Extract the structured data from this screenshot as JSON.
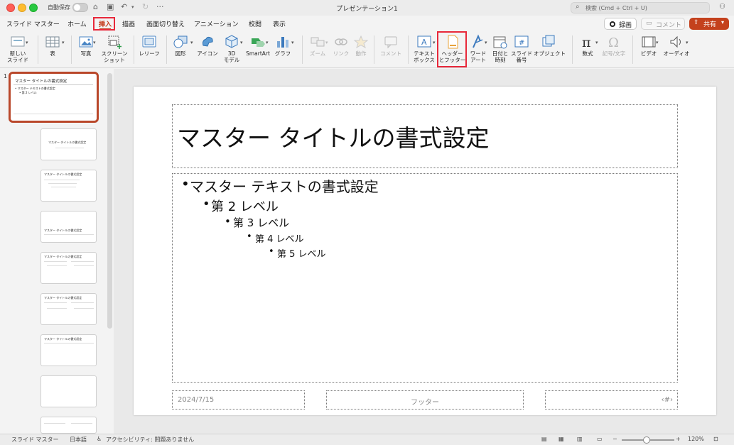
{
  "window": {
    "title": "プレゼンテーション1",
    "autosave_label": "自動保存"
  },
  "search": {
    "placeholder": "検索 (Cmd + Ctrl + U)"
  },
  "tabs": [
    {
      "label": "スライド マスター"
    },
    {
      "label": "ホーム"
    },
    {
      "label": "挿入",
      "active": true
    },
    {
      "label": "描画"
    },
    {
      "label": "画面切り替え"
    },
    {
      "label": "アニメーション"
    },
    {
      "label": "校閲"
    },
    {
      "label": "表示"
    }
  ],
  "top_buttons": {
    "record": "録画",
    "comment": "コメント",
    "share": "共有"
  },
  "ribbon": {
    "new_slide": "新しい\nスライド",
    "table": "表",
    "photo": "写真",
    "screenshot": "スクリーン\nショット",
    "relief": "レリーフ",
    "shapes": "図形",
    "icons": "アイコン",
    "model3d": "3D\nモデル",
    "smartart": "SmartArt",
    "chart": "グラフ",
    "zoom": "ズーム",
    "link": "リンク",
    "action": "動作",
    "comment": "コメント",
    "textbox": "テキスト\nボックス",
    "header_footer": "ヘッダー\nとフッター",
    "wordart": "ワード\nアート",
    "datetime": "日付と\n時刻",
    "slide_number": "スライド\n番号",
    "object": "オブジェクト",
    "equation": "数式",
    "symbol": "記号/文字",
    "video": "ビデオ",
    "audio": "オーディオ"
  },
  "thumbnails": {
    "first_number": "1",
    "master_title": "マスター タイトルの書式設定",
    "master_text": "• マスター テキストの書式設定",
    "level2": "• 第 2 レベル"
  },
  "slide": {
    "title": "マスター タイトルの書式設定",
    "bullets": [
      {
        "text": "マスター テキストの書式設定",
        "level": 1
      },
      {
        "text": "第 2 レベル",
        "level": 2
      },
      {
        "text": "第 3 レベル",
        "level": 3
      },
      {
        "text": "第 4 レベル",
        "level": 4
      },
      {
        "text": "第 5 レベル",
        "level": 5
      }
    ],
    "footer_date": "2024/7/15",
    "footer_text": "フッター",
    "footer_number": "‹#›"
  },
  "status_bar": {
    "view": "スライド マスター",
    "language": "日本語",
    "accessibility": "アクセシビリティ: 問題ありません",
    "zoom": "120%"
  },
  "colors": {
    "accent": "#c43b1c",
    "highlight": "#e8283a",
    "share": "#c4411d"
  }
}
